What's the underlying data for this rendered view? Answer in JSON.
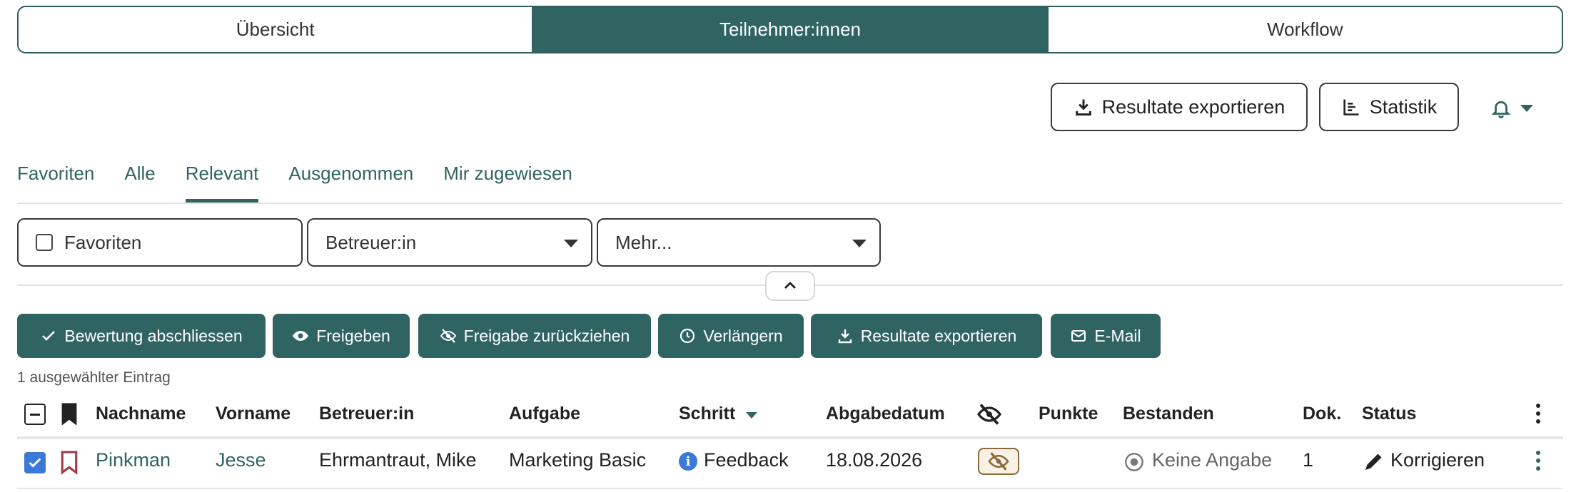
{
  "top_tabs": [
    {
      "label": "Übersicht",
      "active": false
    },
    {
      "label": "Teilnehmer:innen",
      "active": true
    },
    {
      "label": "Workflow",
      "active": false
    }
  ],
  "header_actions": {
    "export_label": "Resultate exportieren",
    "stats_label": "Statistik"
  },
  "sub_tabs": [
    {
      "label": "Favoriten"
    },
    {
      "label": "Alle"
    },
    {
      "label": "Relevant",
      "active": true
    },
    {
      "label": "Ausgenommen"
    },
    {
      "label": "Mir zugewiesen"
    }
  ],
  "filters": {
    "favorites_label": "Favoriten",
    "supervisor_label": "Betreuer:in",
    "more_label": "Mehr..."
  },
  "bulk_actions": {
    "finish": "Bewertung abschliessen",
    "release": "Freigeben",
    "withdraw": "Freigabe zurückziehen",
    "extend": "Verlängern",
    "export": "Resultate exportieren",
    "email": "E-Mail"
  },
  "selection_info": "1 ausgewählter Eintrag",
  "table": {
    "headers": {
      "lastname": "Nachname",
      "firstname": "Vorname",
      "supervisor": "Betreuer:in",
      "task": "Aufgabe",
      "step": "Schritt",
      "due": "Abgabedatum",
      "points": "Punkte",
      "passed": "Bestanden",
      "docs": "Dok.",
      "status": "Status"
    },
    "rows": [
      {
        "lastname": "Pinkman",
        "firstname": "Jesse",
        "supervisor": "Ehrmantraut, Mike",
        "task": "Marketing Basic",
        "step": "Feedback",
        "due": "18.08.2026",
        "points": "",
        "passed": "Keine Angabe",
        "docs": "1",
        "status": "Korrigieren",
        "selected": true
      }
    ]
  },
  "colors": {
    "accent": "#2f6463",
    "info": "#3b78d8",
    "bookmark": "#9b3b4a",
    "hidden_badge": "#8a6a3c"
  }
}
